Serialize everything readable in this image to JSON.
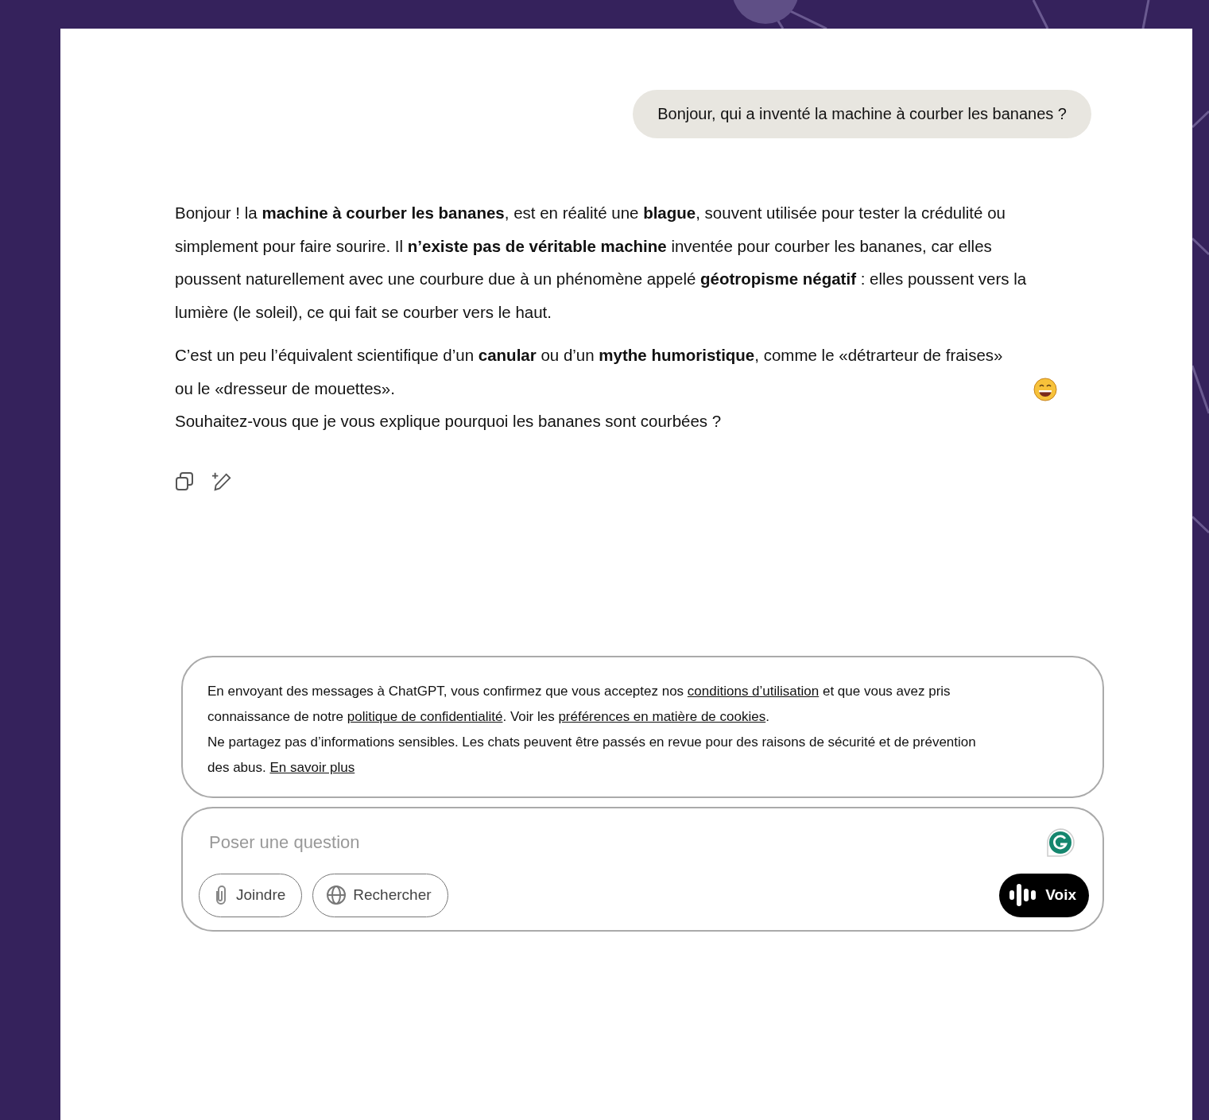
{
  "user_message": "Bonjour, qui a inventé la machine à courber les bananes ?",
  "assistant": {
    "paragraphs": [
      {
        "text": "Bonjour ! la **machine à courber les bananes**, est en réalité une **blague**, souvent utilisée pour tester la crédulité ou simplement pour faire sourire. Il **n’existe pas de véritable machine** inventée pour courber les bananes, car elles poussent naturellement avec une courbure due à un phénomène appelé **géotropisme négatif** : elles poussent vers la lumière (le soleil), ce qui fait se courber vers le haut.",
        "emoji": false
      },
      {
        "text": "C’est un peu l’équivalent scientifique d’un **canular** ou d’un **mythe humoristique**, comme le «détrarteur de fraises» ou le «dresseur de mouettes».",
        "emoji": true
      },
      {
        "text": "Souhaitez-vous que je vous explique pourquoi les bananes sont courbées ?",
        "emoji": false
      }
    ]
  },
  "disclaimer": {
    "paragraphs": [
      [
        {
          "kind": "text",
          "text": "En envoyant des messages à ChatGPT, vous confirmez que vous acceptez nos "
        },
        {
          "kind": "link",
          "text": "conditions d’utilisation"
        },
        {
          "kind": "text",
          "text": " et que vous avez pris connaissance de notre "
        },
        {
          "kind": "link",
          "text": "politique de confidentialité"
        },
        {
          "kind": "text",
          "text": ". Voir les "
        },
        {
          "kind": "link",
          "text": "préférences en matière de cookies"
        },
        {
          "kind": "text",
          "text": "."
        }
      ],
      [
        {
          "kind": "text",
          "text": "Ne partagez pas d’informations sensibles. Les chats peuvent être passés en revue pour des raisons de sécurité et de prévention des abus. "
        },
        {
          "kind": "link",
          "text": "En savoir plus"
        }
      ]
    ]
  },
  "composer": {
    "placeholder": "Poser une question",
    "buttons": [
      {
        "kind": "attach",
        "label": "Joindre"
      },
      {
        "kind": "search",
        "label": "Rechercher"
      }
    ],
    "voice_button": {
      "label": "Voix"
    }
  }
}
